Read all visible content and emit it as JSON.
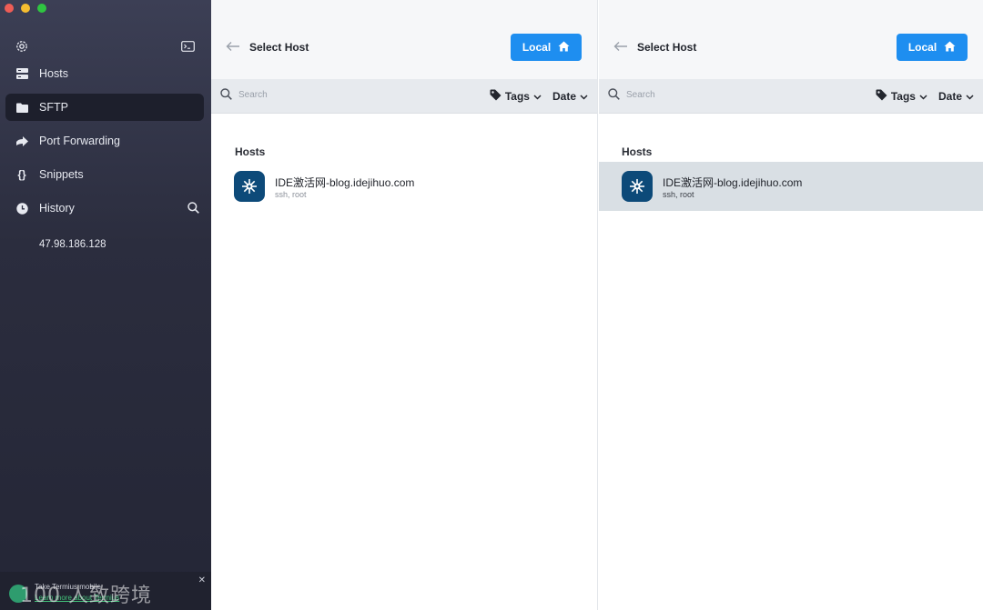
{
  "sidebar": {
    "items": [
      {
        "label": "Hosts",
        "icon": "hosts-icon"
      },
      {
        "label": "SFTP",
        "icon": "folder-icon",
        "active": true
      },
      {
        "label": "Port Forwarding",
        "icon": "arrow-forward-icon"
      },
      {
        "label": "Snippets",
        "icon": "braces-icon"
      },
      {
        "label": "History",
        "icon": "clock-icon"
      }
    ],
    "history_entry": "47.98.186.128",
    "promo": {
      "line1": "Take Termius mobile",
      "line2": "Learn more about Termius",
      "watermark": "100 人致跨境"
    }
  },
  "panels": [
    {
      "title": "Select Host",
      "local_label": "Local",
      "search_placeholder": "Search",
      "tags_label": "Tags",
      "date_label": "Date",
      "section": "Hosts",
      "host": {
        "name": "IDE激活网-blog.idejihuo.com",
        "sub": "ssh, root",
        "selected": false
      }
    },
    {
      "title": "Select Host",
      "local_label": "Local",
      "search_placeholder": "Search",
      "tags_label": "Tags",
      "date_label": "Date",
      "section": "Hosts",
      "host": {
        "name": "IDE激活网-blog.idejihuo.com",
        "sub": "ssh, root",
        "selected": true
      }
    }
  ],
  "colors": {
    "accent": "#1e8ef0",
    "host_icon_bg": "#0d4a79",
    "selected_row": "#d9dfe4"
  }
}
